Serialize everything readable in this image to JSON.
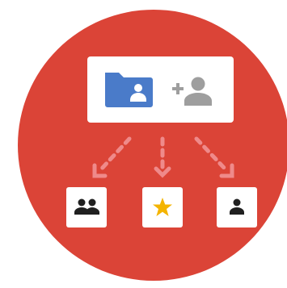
{
  "illustration": {
    "description_icon": "shared-folder-illustration",
    "colors": {
      "circle": "#DB4437",
      "card": "#FFFFFF",
      "folder": "#4A7BC9",
      "folder_person": "#FFFFFF",
      "add_person": "#9E9E9E",
      "arrows": "#EF8A8A",
      "tile_icon": "#202020",
      "star": "#F4B400"
    },
    "top_card": {
      "icons": [
        "shared-folder-icon",
        "add-person-icon"
      ]
    },
    "targets": [
      {
        "icon": "group-icon"
      },
      {
        "icon": "star-icon"
      },
      {
        "icon": "person-icon"
      }
    ]
  }
}
